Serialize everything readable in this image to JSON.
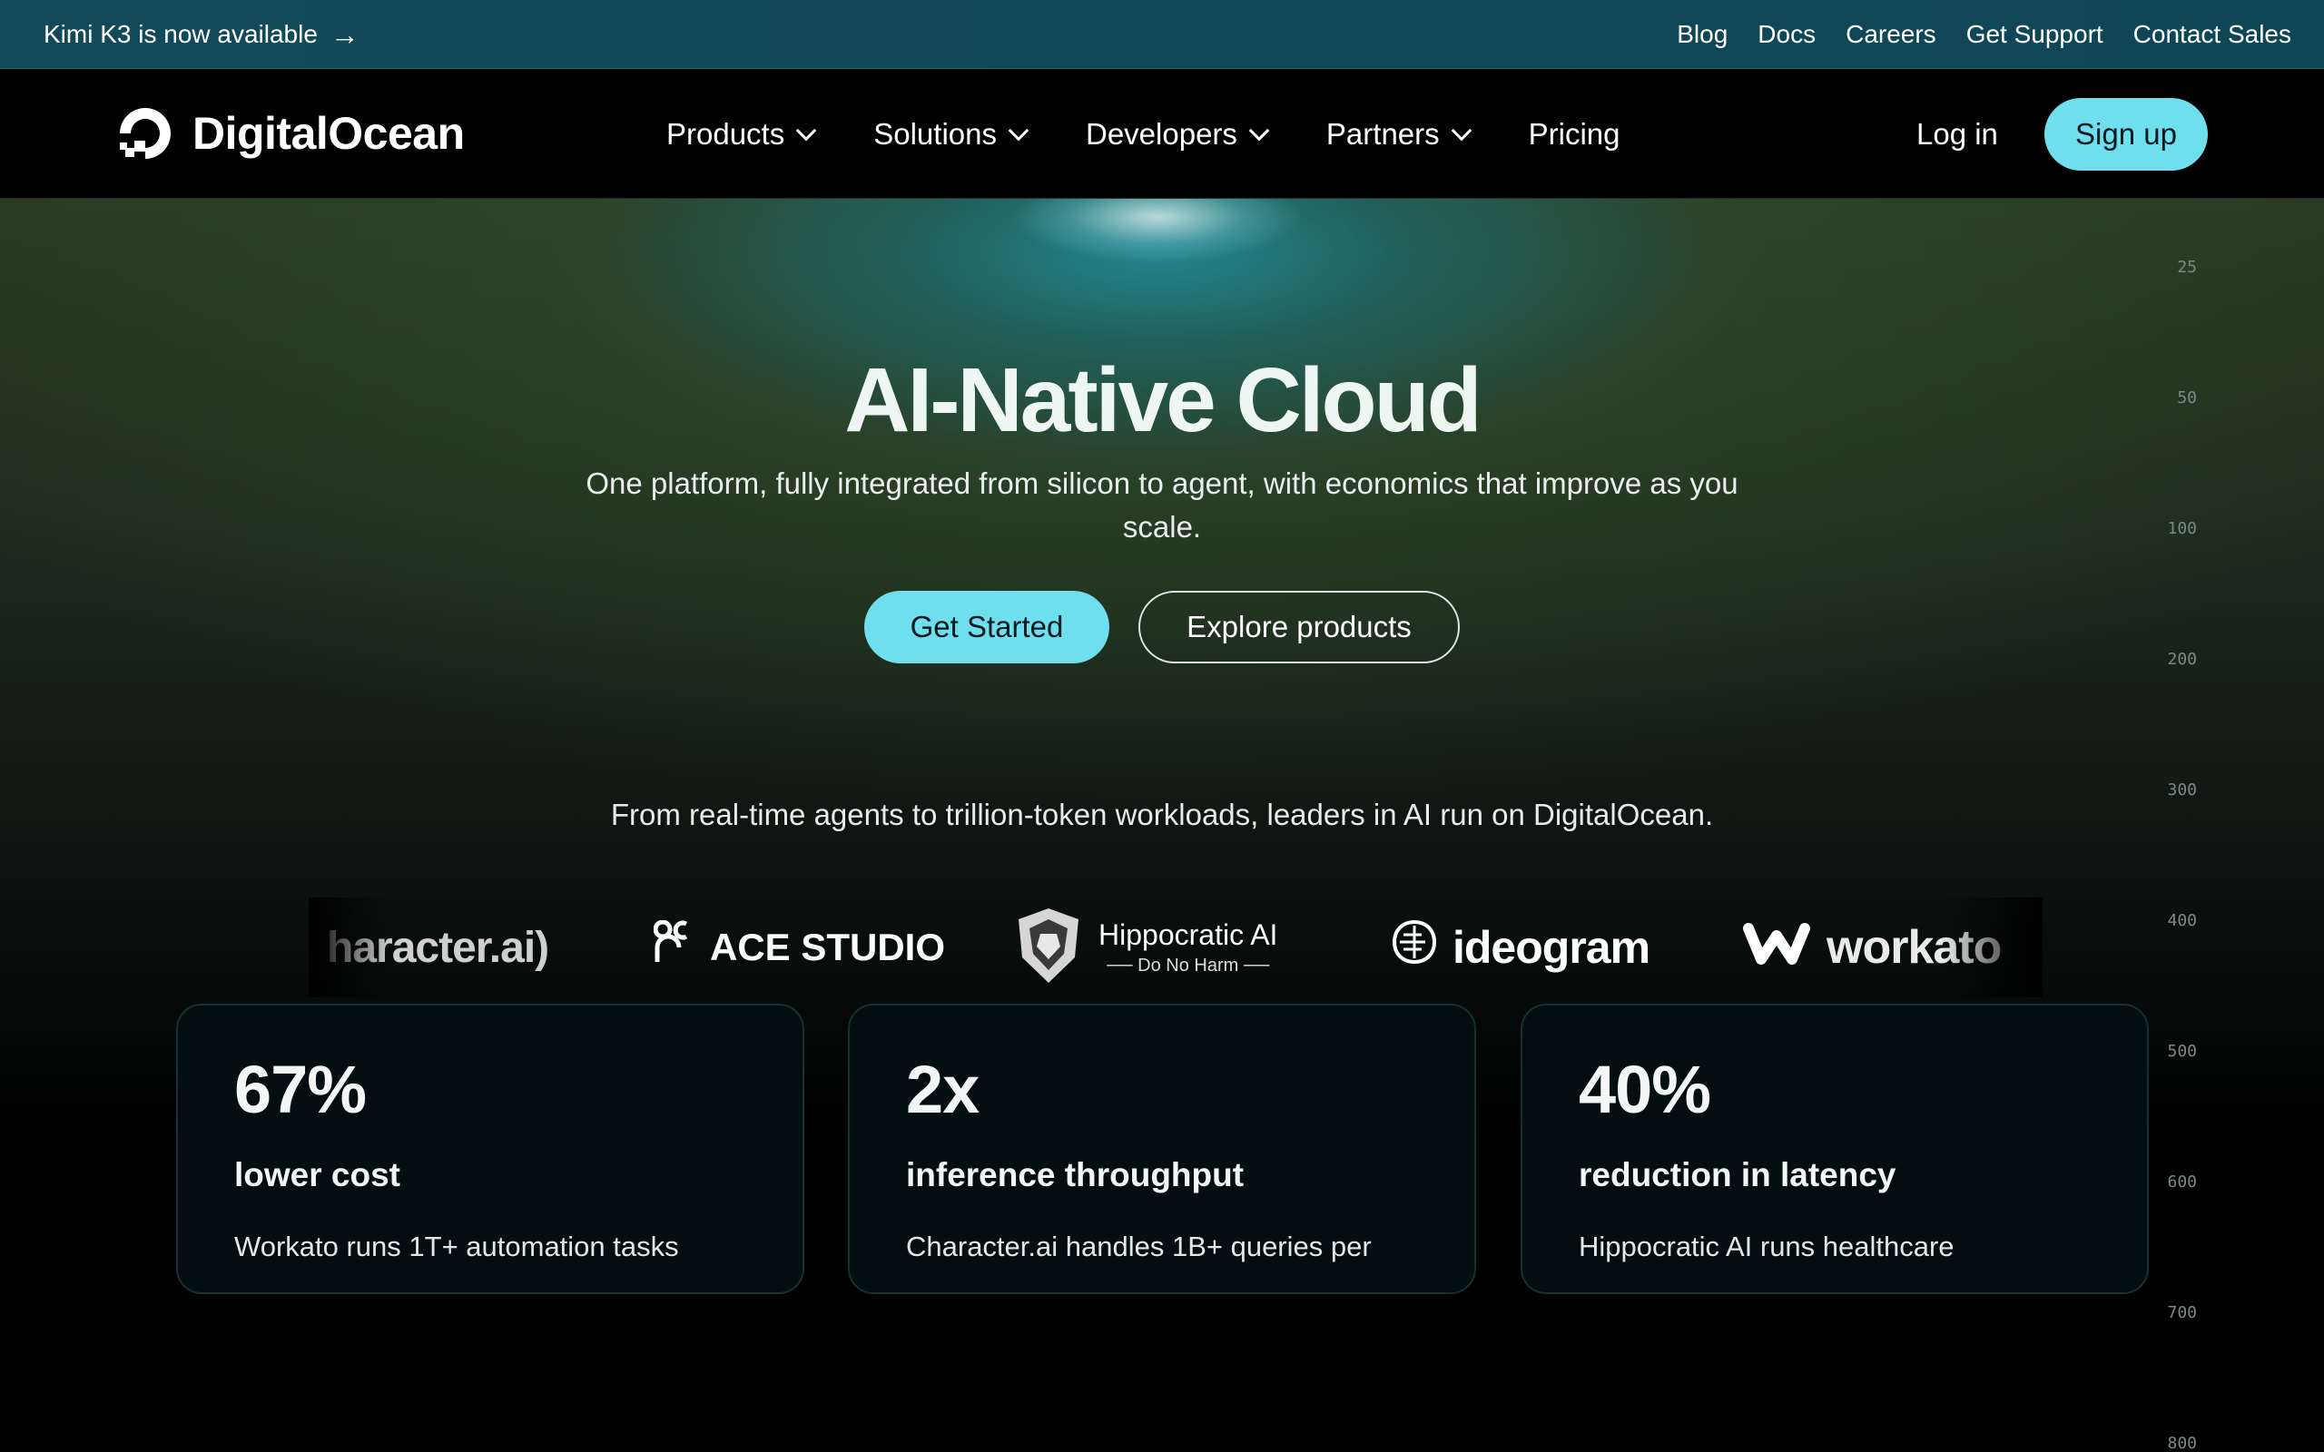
{
  "announcement": {
    "text": "Kimi K3 is now available",
    "arrow": "→"
  },
  "top_links": [
    "Blog",
    "Docs",
    "Careers",
    "Get Support",
    "Contact Sales"
  ],
  "brand": {
    "name": "DigitalOcean",
    "accent": "#6fdfee"
  },
  "nav": {
    "items": [
      {
        "label": "Products",
        "dropdown": true
      },
      {
        "label": "Solutions",
        "dropdown": true
      },
      {
        "label": "Developers",
        "dropdown": true
      },
      {
        "label": "Partners",
        "dropdown": true
      },
      {
        "label": "Pricing",
        "dropdown": false
      }
    ],
    "login": "Log in",
    "signup": "Sign up"
  },
  "hero": {
    "title": "AI-Native Cloud",
    "subtitle": "One platform, fully integrated from silicon to agent, with economics that improve as you scale.",
    "primary_cta": "Get Started",
    "secondary_cta": "Explore products",
    "tagline": "From real-time agents to trillion-token workloads, leaders in AI run on DigitalOcean."
  },
  "scale_labels": [
    "25",
    "50",
    "100",
    "200",
    "300",
    "400",
    "500",
    "600",
    "700",
    "800"
  ],
  "customer_logos": {
    "character": "haracter.ai)",
    "ace": "ACE STUDIO",
    "hippocratic": {
      "name": "Hippocratic AI",
      "motto": "Do No Harm"
    },
    "ideogram": "ideogram",
    "workato": "workato"
  },
  "stats": [
    {
      "value": "67%",
      "label": "lower cost",
      "desc": "Workato runs 1T+ automation tasks"
    },
    {
      "value": "2x",
      "label": "inference throughput",
      "desc": "Character.ai handles 1B+ queries per"
    },
    {
      "value": "40%",
      "label": "reduction in latency",
      "desc": "Hippocratic AI runs healthcare"
    }
  ]
}
